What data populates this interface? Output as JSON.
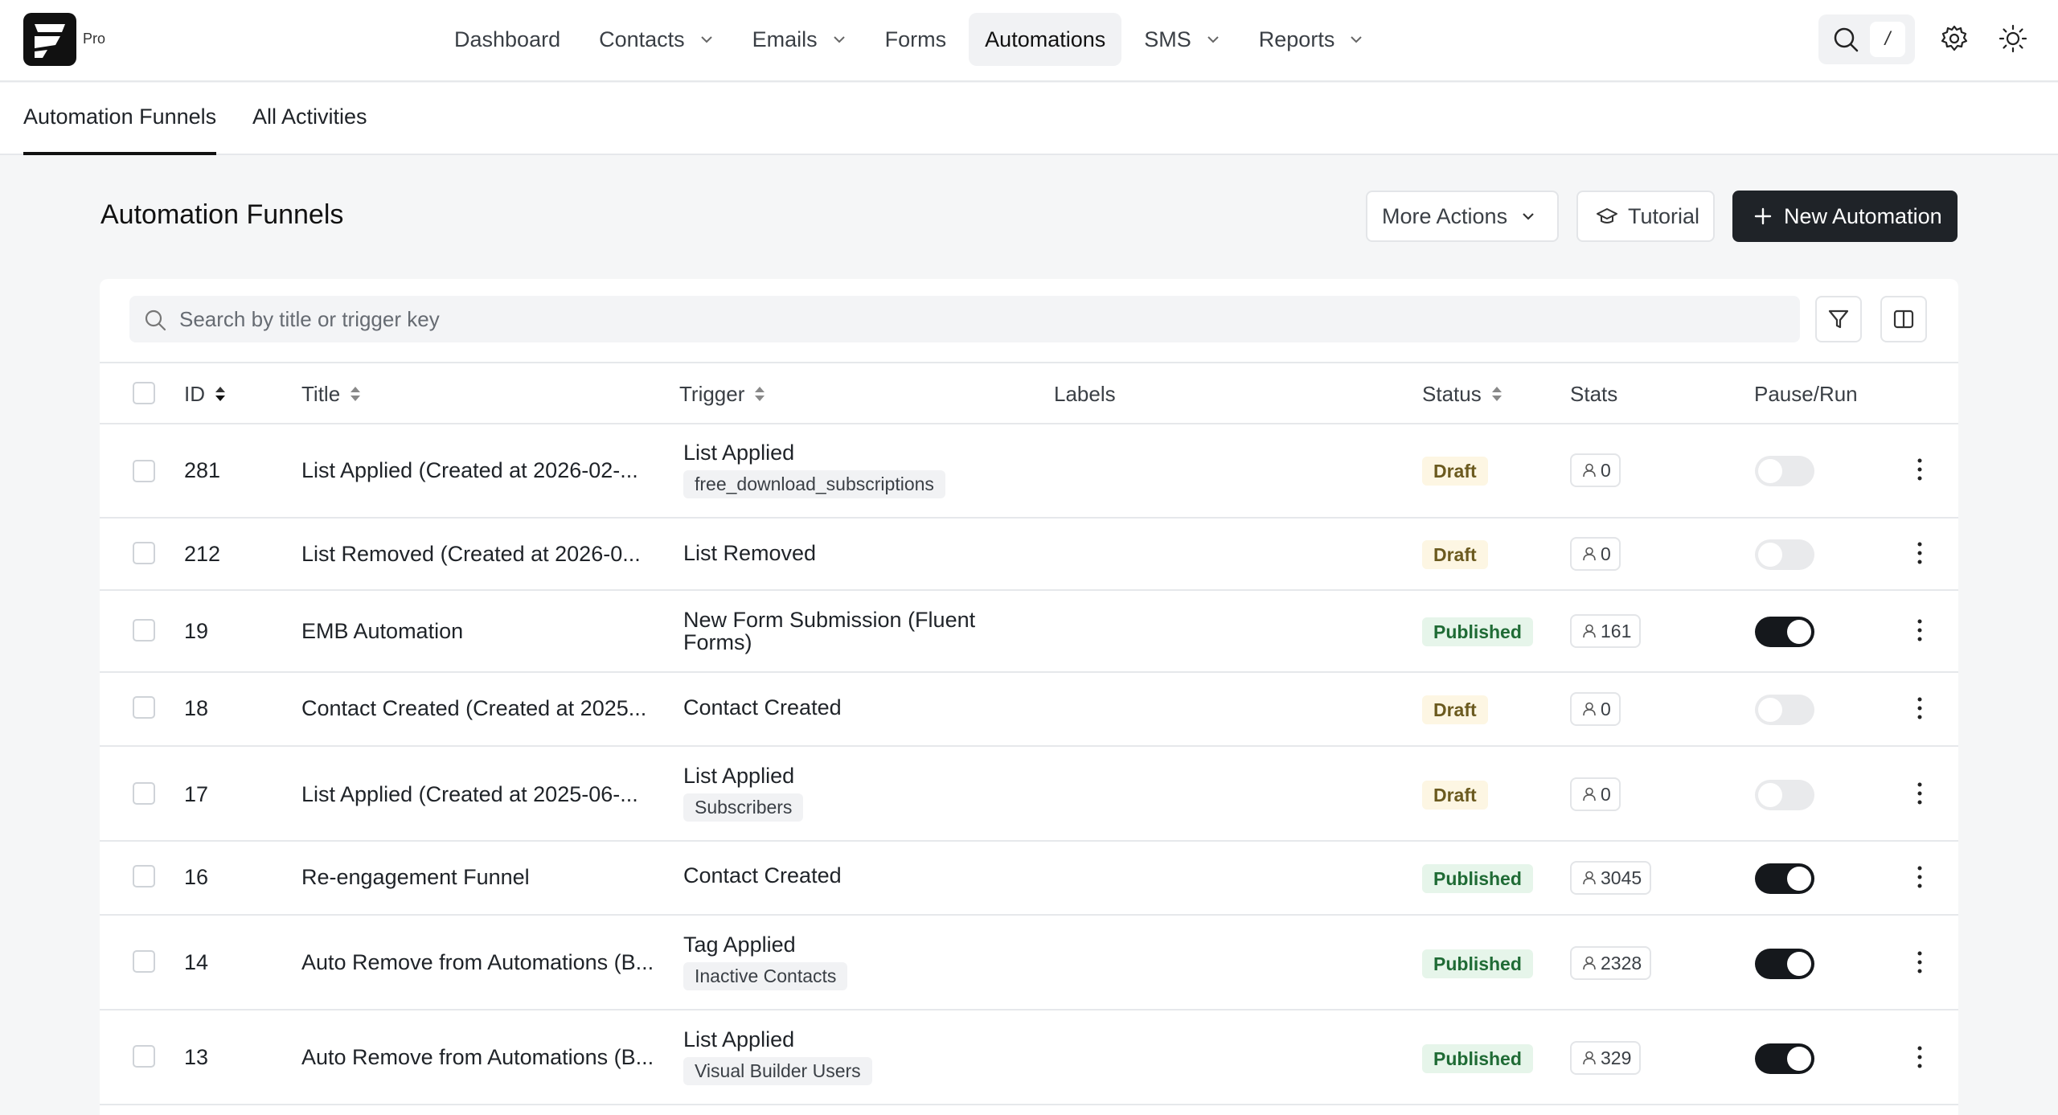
{
  "app": {
    "logo_sub": "Pro"
  },
  "nav": [
    {
      "label": "Dashboard",
      "has_dropdown": false
    },
    {
      "label": "Contacts",
      "has_dropdown": true
    },
    {
      "label": "Emails",
      "has_dropdown": true
    },
    {
      "label": "Forms",
      "has_dropdown": false
    },
    {
      "label": "Automations",
      "has_dropdown": false,
      "active": true
    },
    {
      "label": "SMS",
      "has_dropdown": true
    },
    {
      "label": "Reports",
      "has_dropdown": true
    }
  ],
  "search_shortcut": "/",
  "subtabs": [
    {
      "label": "Automation Funnels",
      "active": true
    },
    {
      "label": "All Activities",
      "active": false
    }
  ],
  "page": {
    "title": "Automation Funnels",
    "more_actions_label": "More Actions",
    "tutorial_label": "Tutorial",
    "new_automation_label": "New Automation"
  },
  "search": {
    "placeholder": "Search by title or trigger key"
  },
  "columns": {
    "id": "ID",
    "title": "Title",
    "trigger": "Trigger",
    "labels": "Labels",
    "status": "Status",
    "stats": "Stats",
    "pause_run": "Pause/Run"
  },
  "rows": [
    {
      "id": "281",
      "title": "List Applied (Created at 2026-02-...",
      "trigger": "List Applied",
      "trigger_tag": "free_download_subscriptions",
      "status": "Draft",
      "stats": "0",
      "running": false
    },
    {
      "id": "212",
      "title": "List Removed (Created at 2026-0...",
      "trigger": "List Removed",
      "trigger_tag": "",
      "status": "Draft",
      "stats": "0",
      "running": false
    },
    {
      "id": "19",
      "title": "EMB Automation",
      "trigger": "New Form Submission (Fluent Forms)",
      "trigger_tag": "",
      "status": "Published",
      "stats": "161",
      "running": true
    },
    {
      "id": "18",
      "title": "Contact Created (Created at 2025...",
      "trigger": "Contact Created",
      "trigger_tag": "",
      "status": "Draft",
      "stats": "0",
      "running": false
    },
    {
      "id": "17",
      "title": "List Applied (Created at 2025-06-...",
      "trigger": "List Applied",
      "trigger_tag": "Subscribers",
      "status": "Draft",
      "stats": "0",
      "running": false
    },
    {
      "id": "16",
      "title": "Re-engagement Funnel",
      "trigger": "Contact Created",
      "trigger_tag": "",
      "status": "Published",
      "stats": "3045",
      "running": true
    },
    {
      "id": "14",
      "title": "Auto Remove from Automations (B...",
      "trigger": "Tag Applied",
      "trigger_tag": "Inactive Contacts",
      "status": "Published",
      "stats": "2328",
      "running": true
    },
    {
      "id": "13",
      "title": "Auto Remove from Automations (B...",
      "trigger": "List Applied",
      "trigger_tag": "Visual Builder Users",
      "status": "Published",
      "stats": "329",
      "running": true
    }
  ]
}
